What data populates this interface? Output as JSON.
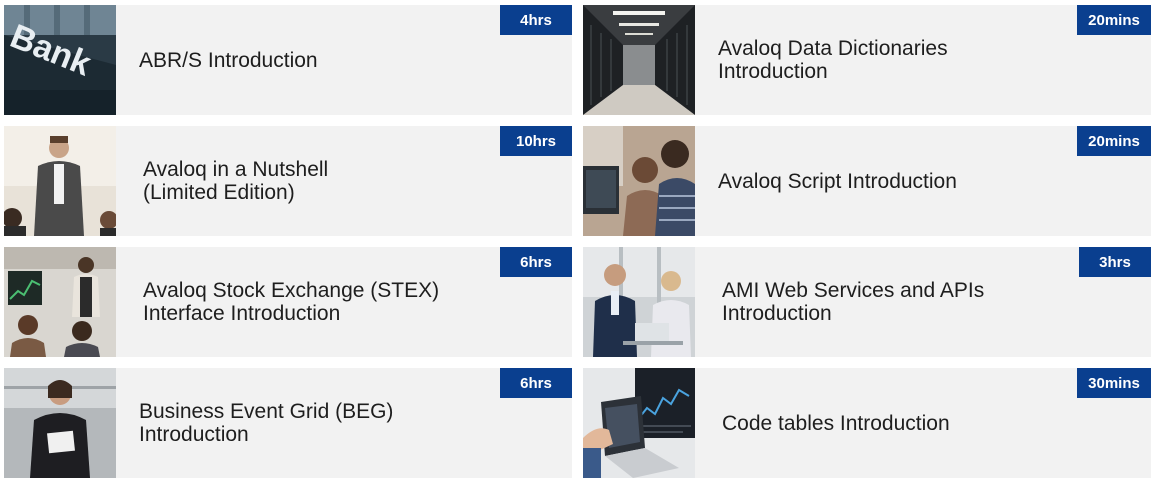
{
  "courses": [
    {
      "title": "ABR/S Introduction",
      "duration": "4hrs",
      "image_sign_text": "Bank"
    },
    {
      "title": "Avaloq Data Dictionaries\nIntroduction",
      "duration": "20mins"
    },
    {
      "title": "Avaloq in a Nutshell\n(Limited Edition)",
      "duration": "10hrs"
    },
    {
      "title": "Avaloq Script Introduction",
      "duration": "20mins"
    },
    {
      "title": "Avaloq Stock Exchange (STEX)\nInterface Introduction",
      "duration": "6hrs"
    },
    {
      "title": "AMI Web Services and APIs\nIntroduction",
      "duration": "3hrs"
    },
    {
      "title": "Business Event Grid (BEG)\nIntroduction",
      "duration": "6hrs"
    },
    {
      "title": "Code tables Introduction",
      "duration": "30mins"
    }
  ],
  "colors": {
    "badge_background": "#0a3f8f",
    "badge_text": "#ffffff",
    "card_background": "#f2f2f2",
    "title_text": "#1e1e1e"
  }
}
